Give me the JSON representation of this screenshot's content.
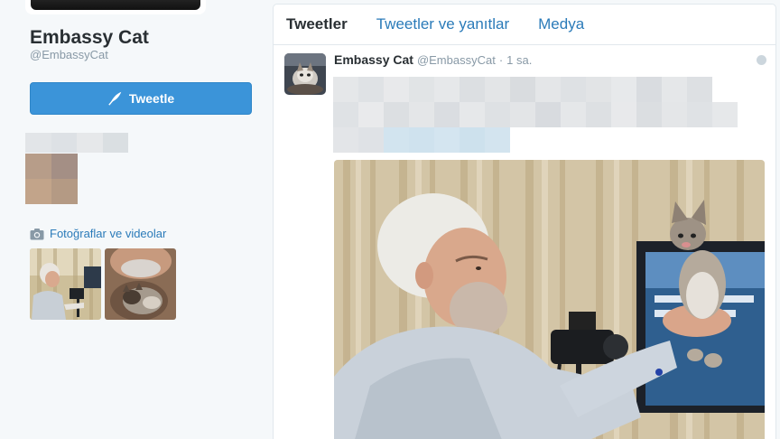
{
  "profile": {
    "name": "Embassy Cat",
    "handle": "@EmbassyCat",
    "tweet_button": "Tweetle",
    "media_link": "Fotoğraflar ve videolar",
    "blur_strip_colors": [
      "#e2e5e8",
      "#dde1e5",
      "#e6e8ea",
      "#dadfe2"
    ],
    "blur_square_colors": [
      "#b79d89",
      "#a48f85",
      "#c2a48a",
      "#b49a84"
    ]
  },
  "timeline": {
    "tabs": [
      {
        "label": "Tweetler"
      },
      {
        "label": "Tweetler ve yanıtlar"
      },
      {
        "label": "Medya"
      }
    ],
    "tweet": {
      "name": "Embassy Cat",
      "handle": "@EmbassyCat",
      "separator": "·",
      "time": "1 sa."
    }
  },
  "colors": {
    "accent": "#3b94d9",
    "link": "#2b7bb9",
    "page_bg": "#f5f8fa",
    "muted": "#8899a6"
  }
}
